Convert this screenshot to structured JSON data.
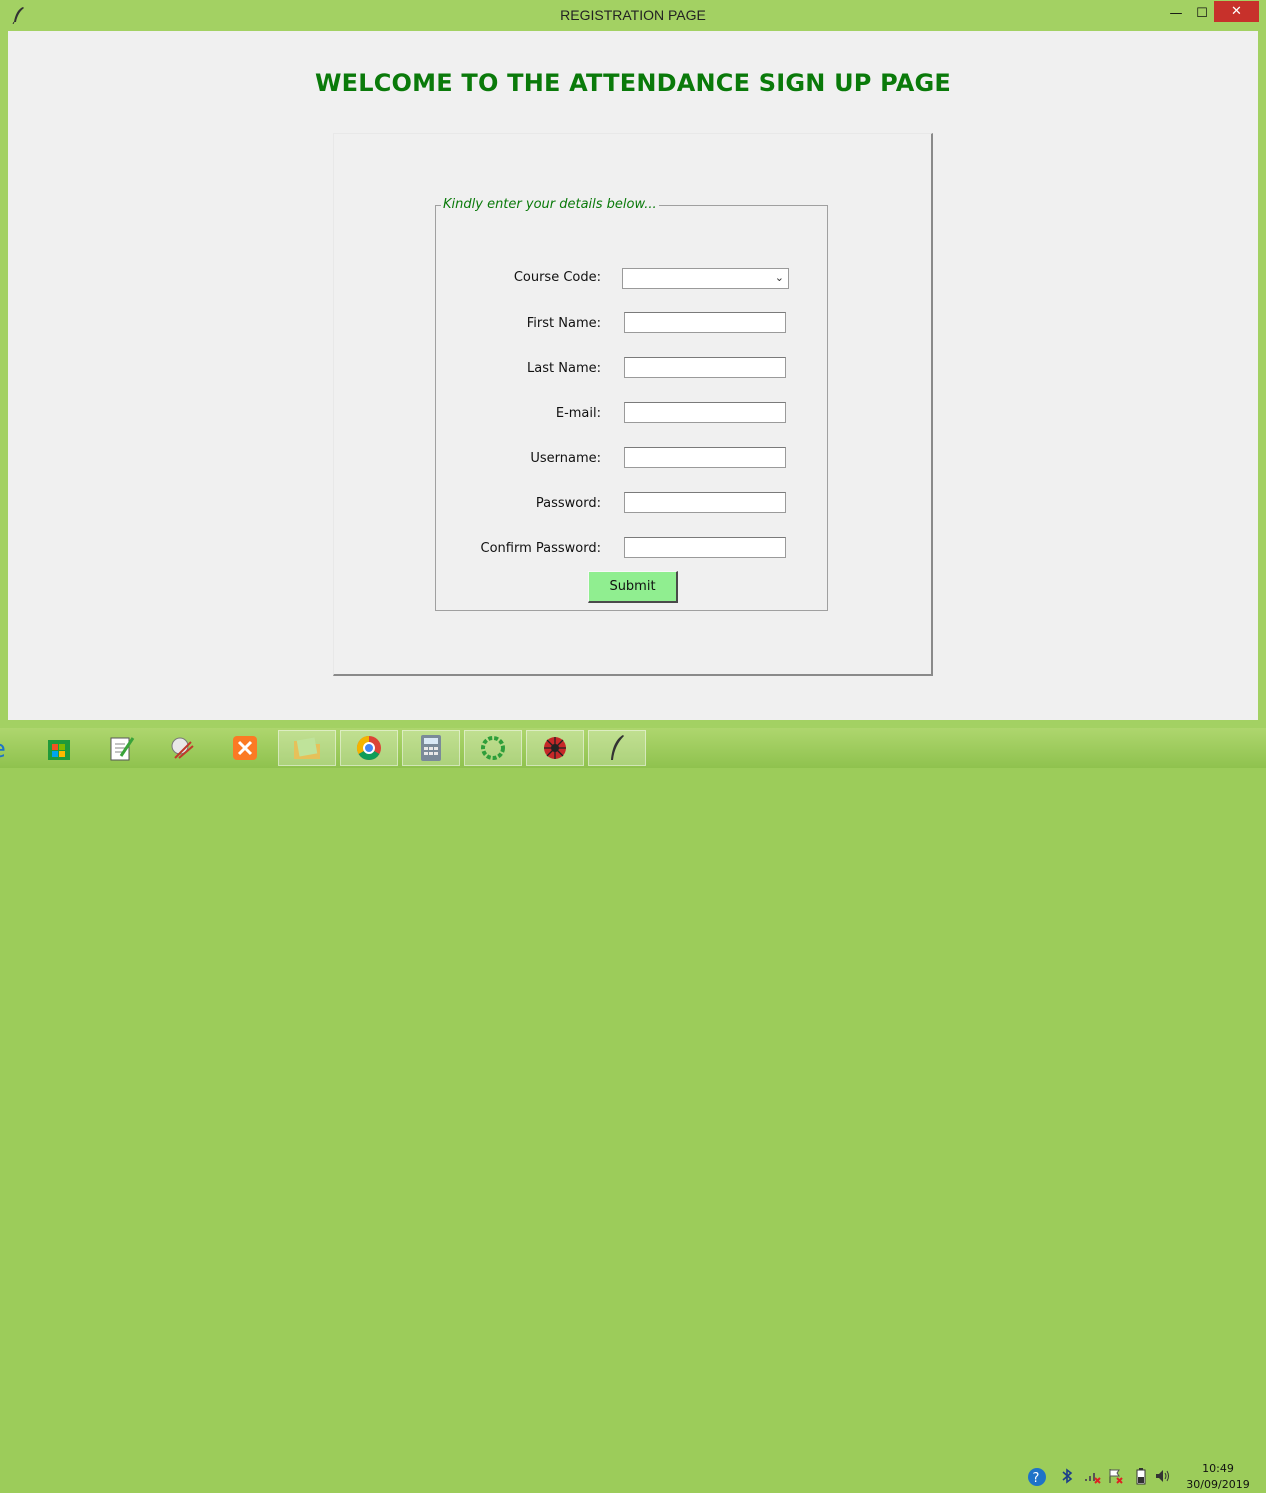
{
  "window": {
    "title": "REGISTRATION PAGE",
    "minimize_symbol": "—",
    "maximize_symbol": "☐",
    "close_symbol": "✕"
  },
  "page": {
    "heading": "WELCOME TO THE ATTENDANCE SIGN UP PAGE",
    "group_title": "Kindly enter your details below...",
    "fields": [
      {
        "label": "Course Code:",
        "value": ""
      },
      {
        "label": "First Name:",
        "value": ""
      },
      {
        "label": "Last Name:",
        "value": ""
      },
      {
        "label": "E-mail:",
        "value": ""
      },
      {
        "label": "Username:",
        "value": ""
      },
      {
        "label": "Password:",
        "value": ""
      },
      {
        "label": "Confirm Password:",
        "value": ""
      }
    ],
    "submit_label": "Submit"
  },
  "taskbar": {
    "apps": [
      "internet-explorer-icon",
      "store-icon",
      "notepad-plus-plus-icon",
      "snipping-tool-icon",
      "xampp-icon",
      "file-explorer-icon",
      "chrome-icon",
      "calculator-icon",
      "loading-ring-icon",
      "spider-app-icon",
      "tk-feather-icon"
    ],
    "time": "10:49",
    "date": "30/09/2019"
  },
  "colors": {
    "accent_green": "#0a7a0a",
    "frame_green": "#a3d163",
    "submit_bg": "#90ee90",
    "close_red": "#c7312b"
  }
}
